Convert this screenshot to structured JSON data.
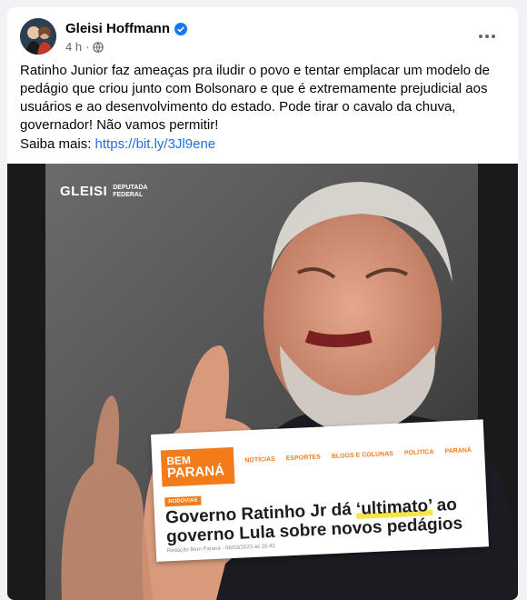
{
  "post": {
    "author": "Gleisi Hoffmann",
    "time": "4 h",
    "separator": "·",
    "text": "Ratinho Junior faz ameaças pra iludir o povo  e tentar emplacar um modelo de pedágio que criou junto com Bolsonaro e que é extremamente prejudicial aos usuários e ao desenvolvimento do estado. Pode tirar o cavalo da chuva, governador! Não vamos permitir!",
    "more_label": "Saiba mais:",
    "link": "https://bit.ly/3Jl9ene"
  },
  "image": {
    "watermark_brand": "GLEISI",
    "watermark_sub1": "DEPUTADA",
    "watermark_sub2": "FEDERAL",
    "news_logo_line1": "BEM",
    "news_logo_line2": "PARANÁ",
    "news_nav": [
      "NOTÍCIAS",
      "ESPORTES",
      "BLOGS E COLUNAS",
      "POLÍTICA",
      "PARANÁ"
    ],
    "badge": "RODOVIAS",
    "headline_part1": "Governo Ratinho Jr dá ",
    "headline_highlight": "‘ultimato’",
    "headline_part2": " ao governo Lula sobre novos pedágios",
    "byline": "Redação Bem Paraná - 06/03/2023 às 16:42"
  },
  "icons": {
    "verified": "verified-badge-icon",
    "audience": "globe-icon",
    "menu": "more-options-icon"
  },
  "colors": {
    "link": "#216fdb",
    "verified": "#1877f2",
    "brand_orange": "#f27c1a"
  }
}
